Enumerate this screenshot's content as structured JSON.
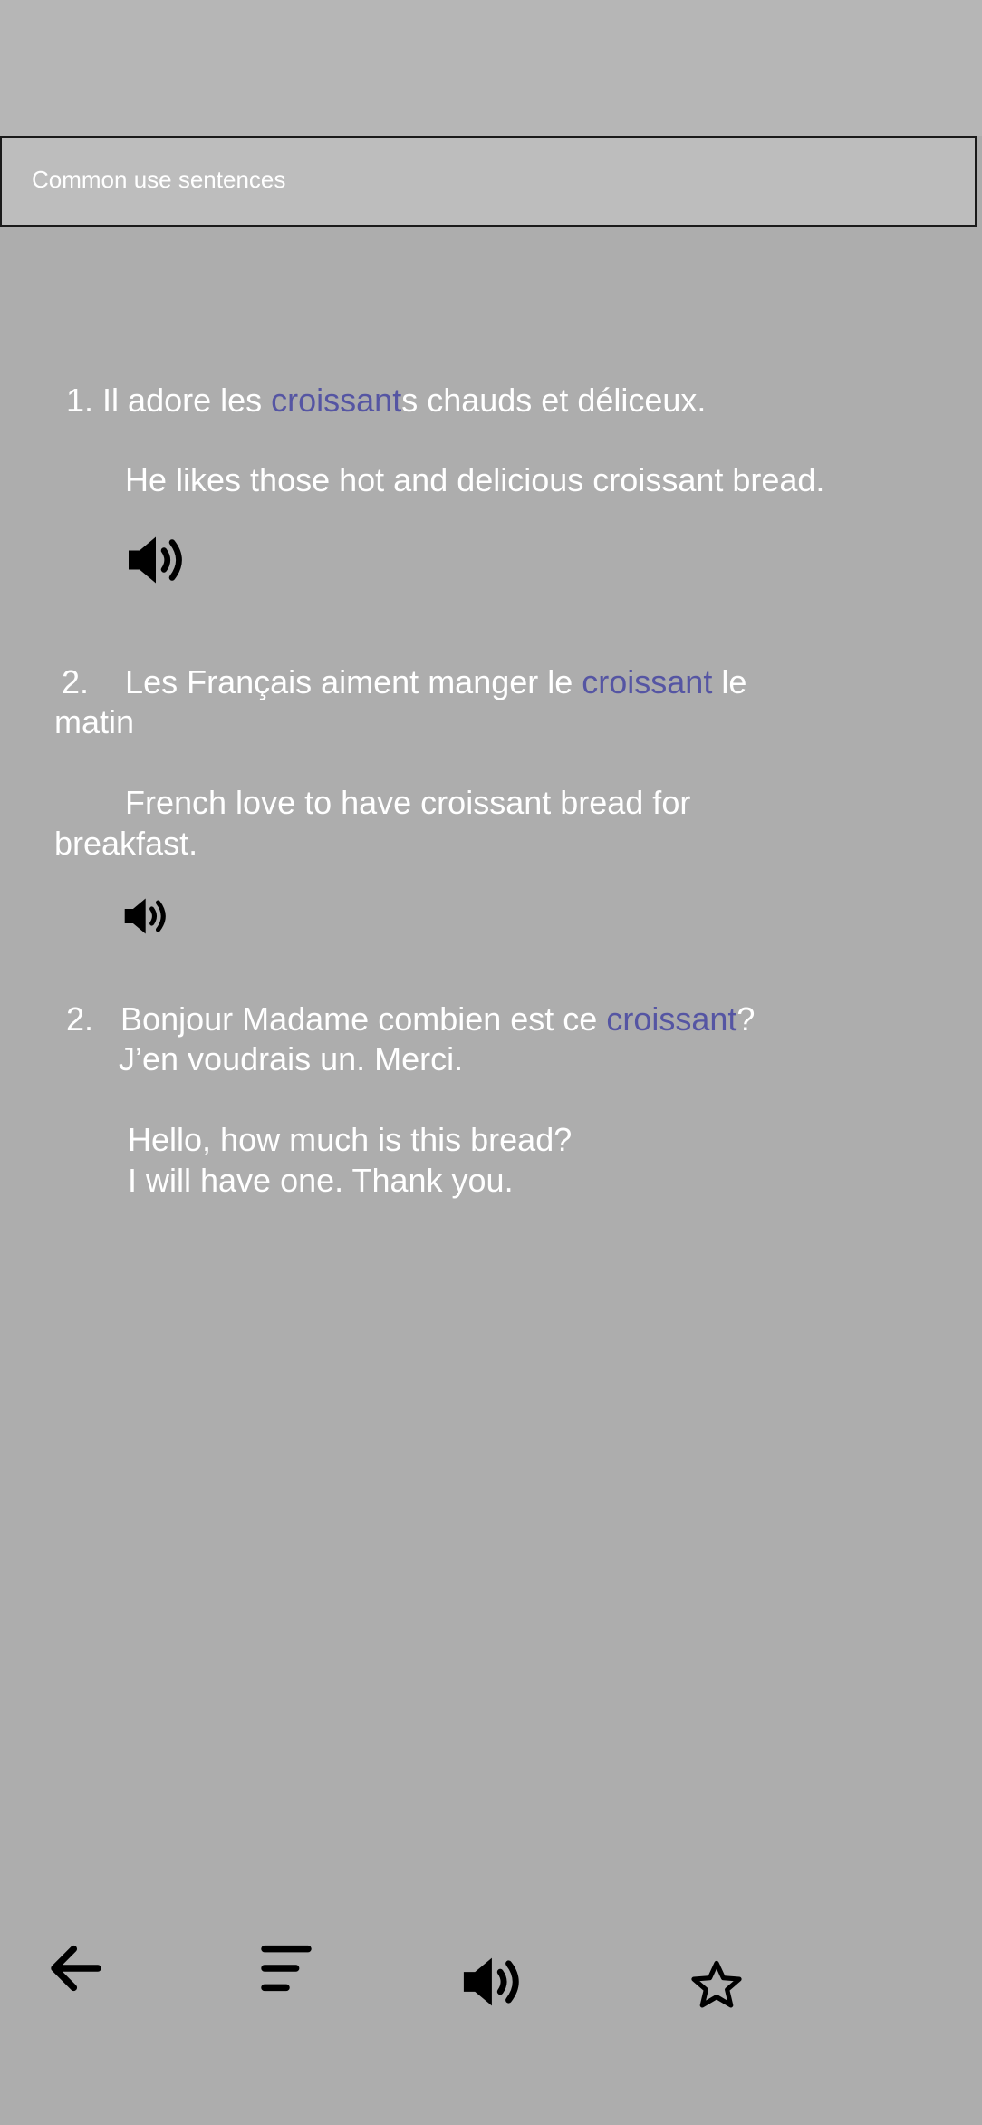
{
  "title": "Common use sentences",
  "colors": {
    "background": "#adadad",
    "highlight": "#5555a3",
    "text": "#ffffff",
    "icon": "#000000"
  },
  "sentences": [
    {
      "number": "1.",
      "french": {
        "before": "Il adore les ",
        "highlight": "croissant",
        "after": "s chauds et déliceux."
      },
      "english": [
        "He likes those hot and delicious croissant bread."
      ],
      "has_audio": true,
      "audio_icon": "speaker-icon"
    },
    {
      "number": "2.",
      "french": {
        "before": "Les Français aiment manger le ",
        "highlight": "croissant",
        "after": " le",
        "line2": "matin"
      },
      "english": [
        "French love to have croissant bread for",
        "breakfast."
      ],
      "has_audio": true,
      "audio_icon": "speaker-icon"
    },
    {
      "number": "2.",
      "french": {
        "before": "Bonjour Madame combien est ce ",
        "highlight": "croissant",
        "after": "?",
        "line2": "J’en voudrais un. Merci."
      },
      "english": [
        "Hello, how much is this bread?",
        "I will have one. Thank you."
      ],
      "has_audio": false
    }
  ],
  "bottom_nav": [
    "back-arrow-icon",
    "menu-icon",
    "speaker-icon",
    "star-icon"
  ]
}
